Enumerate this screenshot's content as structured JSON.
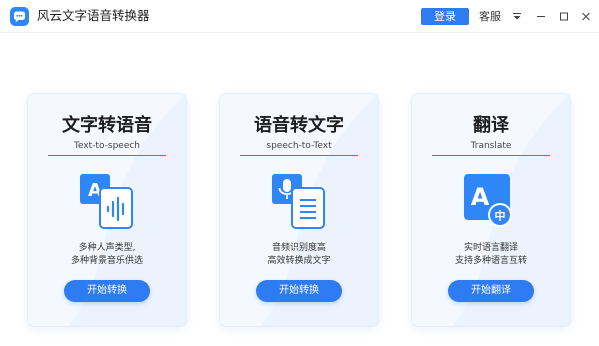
{
  "app": {
    "title": "风云文字语音转换器",
    "login_label": "登录",
    "service_label": "客服"
  },
  "colors": {
    "accent": "#2f7bf1",
    "icon_blue": "#2f86f6",
    "card_bg": "#f5f9ff"
  },
  "cards": [
    {
      "title": "文字转语音",
      "subtitle": "Text-to-speech",
      "icon": "text-to-speech-icon",
      "desc_line1": "多种人声类型,",
      "desc_line2": "多种背景音乐供选",
      "button_label": "开始转换"
    },
    {
      "title": "语音转文字",
      "subtitle": "speech-to-Text",
      "icon": "speech-to-text-icon",
      "desc_line1": "音频识别度高",
      "desc_line2": "高效转换成文字",
      "button_label": "开始转换"
    },
    {
      "title": "翻译",
      "subtitle": "Translate",
      "icon": "translate-icon",
      "desc_line1": "实时语言翻译",
      "desc_line2": "支持多种语言互转",
      "button_label": "开始翻译",
      "icon_glyph_a": "A",
      "icon_glyph_zh": "中"
    }
  ],
  "card0_icon_letter": "A"
}
